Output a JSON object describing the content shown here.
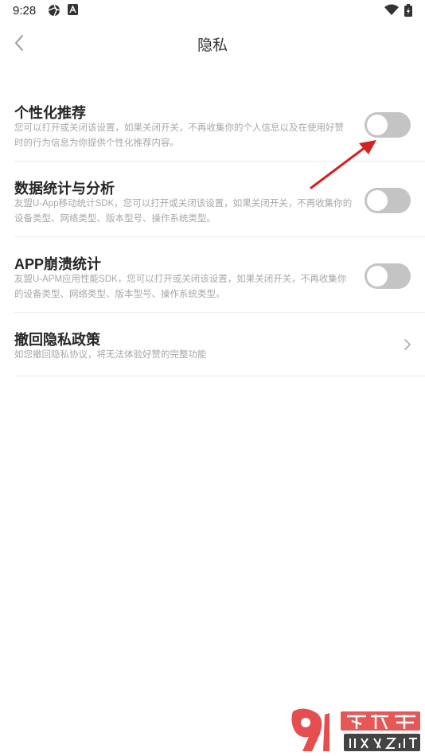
{
  "status": {
    "time": "9:28"
  },
  "header": {
    "title": "隐私"
  },
  "settings": [
    {
      "title": "个性化推荐",
      "desc": "您可以打开或关闭该设置，如果关闭开关，不再收集你的个人信息以及在使用好赞时的行为信息为你提供个性化推荐内容。",
      "enabled": false
    },
    {
      "title": "数据统计与分析",
      "desc": "友盟U-App移动统计SDK，您可以打开或关闭该设置，如果关闭开关，不再收集你的设备类型、网络类型、版本型号、操作系统类型。",
      "enabled": false
    },
    {
      "title": "APP崩溃统计",
      "desc": "友盟U-APM应用性能SDK，您可以打开或关闭该设置，如果关闭开关，不再收集你的设备类型、网络类型、版本型号、操作系统类型。",
      "enabled": false
    },
    {
      "title": "撤回隐私政策",
      "desc": "如您撤回隐私协议，将无法体验好赞的完整功能"
    }
  ],
  "watermark": {
    "logo": "9",
    "name": "下载站",
    "url": "91xz.net"
  },
  "colors": {
    "toggle_off": "#c4c4c4",
    "annotation": "#d42222",
    "watermark": "#e23b3b"
  }
}
